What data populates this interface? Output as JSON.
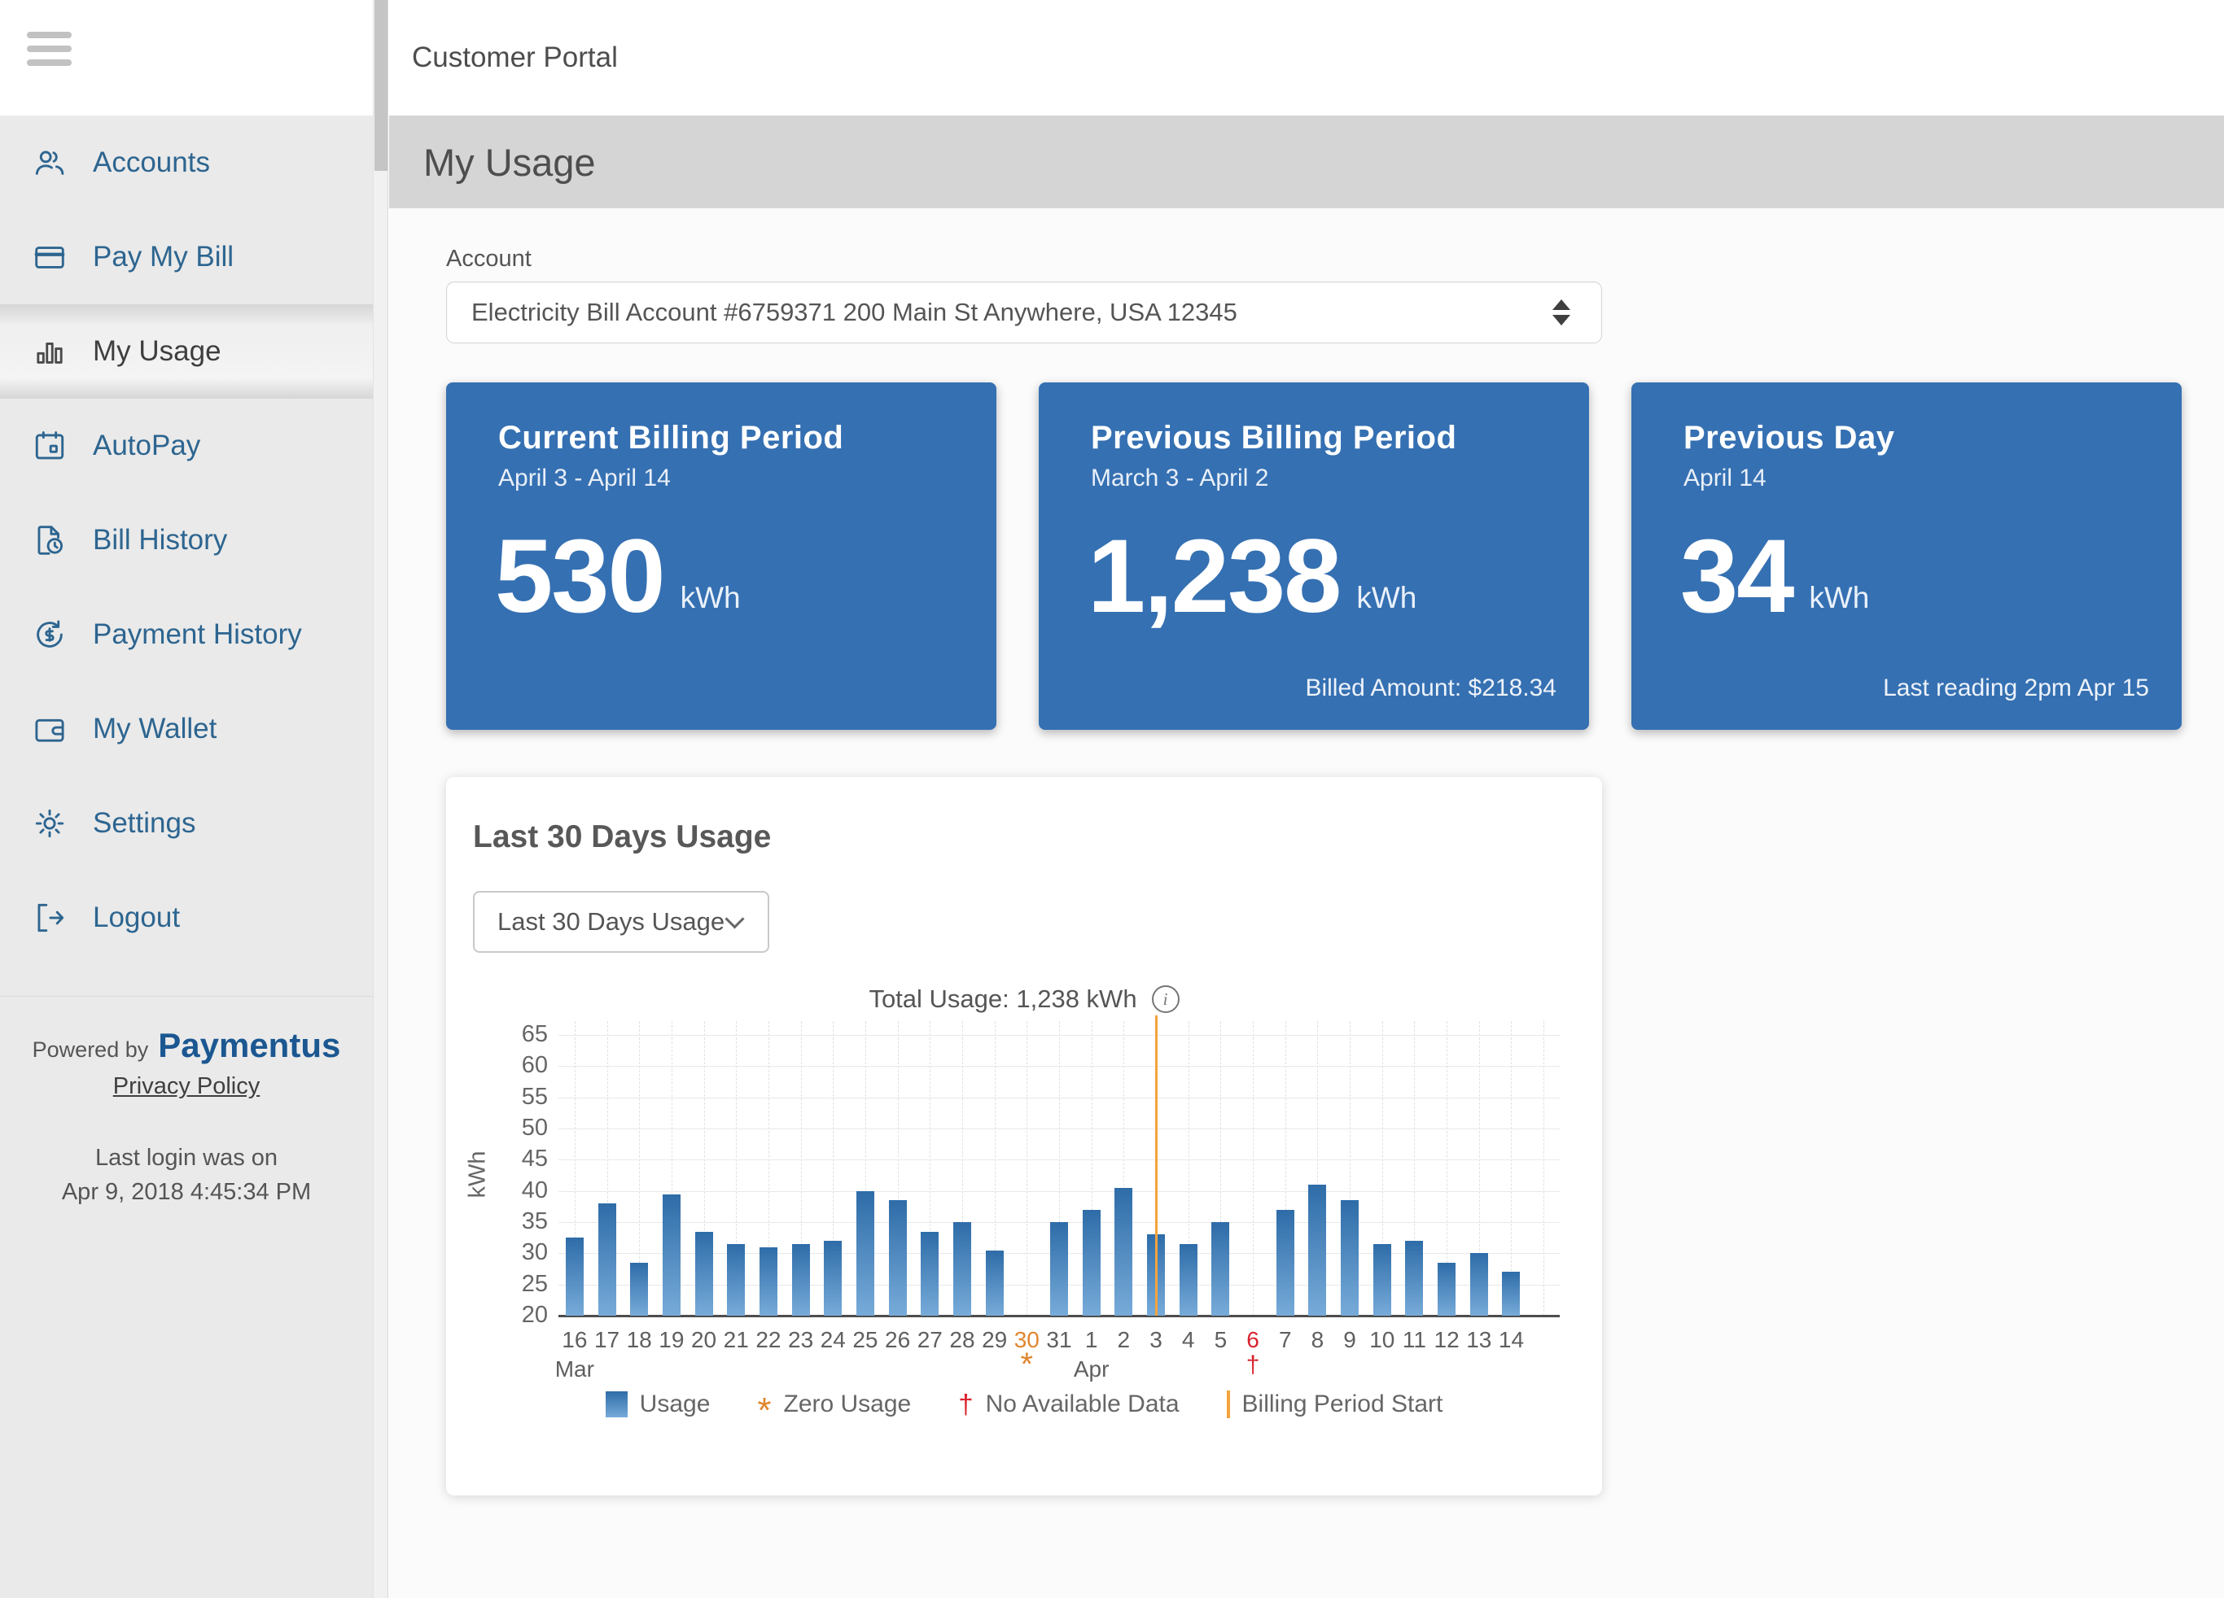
{
  "header": {
    "app_title": "Customer Portal"
  },
  "banner": {
    "page_title": "My Usage"
  },
  "sidebar": {
    "items": [
      {
        "label": "Accounts",
        "icon": "accounts",
        "active": false
      },
      {
        "label": "Pay My Bill",
        "icon": "credit-card",
        "active": false
      },
      {
        "label": "My Usage",
        "icon": "bar-chart",
        "active": true
      },
      {
        "label": "AutoPay",
        "icon": "calendar",
        "active": false
      },
      {
        "label": "Bill History",
        "icon": "document-clock",
        "active": false
      },
      {
        "label": "Payment History",
        "icon": "refresh-dollar",
        "active": false
      },
      {
        "label": "My Wallet",
        "icon": "wallet",
        "active": false
      },
      {
        "label": "Settings",
        "icon": "gear",
        "active": false
      },
      {
        "label": "Logout",
        "icon": "logout",
        "active": false
      }
    ],
    "powered_by": "Powered by",
    "brand": "Paymentus",
    "brand_color": "#1b5791",
    "privacy_policy": "Privacy Policy",
    "last_login_line1": "Last login was on",
    "last_login_line2": "Apr 9, 2018 4:45:34 PM"
  },
  "account": {
    "label": "Account",
    "selected_option": "Electricity Bill Account #6759371 200 Main St Anywhere, USA 12345"
  },
  "summary_cards": [
    {
      "title": "Current Billing Period",
      "subtitle": "April 3 - April 14",
      "value": "530",
      "unit": "kWh",
      "note": ""
    },
    {
      "title": "Previous Billing Period",
      "subtitle": "March 3 - April 2",
      "value": "1,238",
      "unit": "kWh",
      "note": "Billed Amount: $218.34"
    },
    {
      "title": "Previous Day",
      "subtitle": "April 14",
      "value": "34",
      "unit": "kWh",
      "note": "Last reading 2pm Apr 15"
    }
  ],
  "accent_color": "#3570b2",
  "chart_card": {
    "title": "Last 30 Days Usage",
    "dropdown_value": "Last 30 Days Usage",
    "info_glyph": "i"
  },
  "chart_data": {
    "type": "bar",
    "title": "Total Usage: 1,238 kWh",
    "xlabel": "",
    "ylabel": "kWh",
    "ylim": [
      20,
      65
    ],
    "yticks": [
      20,
      25,
      30,
      35,
      40,
      45,
      50,
      55,
      60,
      65
    ],
    "grid": true,
    "legend_position": "bottom",
    "categories": [
      "16",
      "17",
      "18",
      "19",
      "20",
      "21",
      "22",
      "23",
      "24",
      "25",
      "26",
      "27",
      "28",
      "29",
      "30",
      "31",
      "1",
      "2",
      "3",
      "4",
      "5",
      "6",
      "7",
      "8",
      "9",
      "10",
      "11",
      "12",
      "13",
      "14"
    ],
    "month_labels": [
      {
        "index": 0,
        "label": "Mar"
      },
      {
        "index": 16,
        "label": "Apr"
      }
    ],
    "values": [
      32.5,
      38,
      28.5,
      39.5,
      33.5,
      31.5,
      31,
      31.5,
      32,
      40,
      38.5,
      33.5,
      35,
      30.5,
      null,
      35,
      37,
      40.5,
      33,
      31.5,
      35,
      null,
      37,
      41,
      38.5,
      31.5,
      32,
      28.5,
      30,
      27
    ],
    "special": {
      "zero_usage_index": 14,
      "zero_usage_glyph": "*",
      "no_data_index": 21,
      "no_data_glyph": "†",
      "billing_start_index": 18
    },
    "legend": [
      {
        "marker": "bar",
        "label": "Usage"
      },
      {
        "marker": "asterisk",
        "label": "Zero Usage"
      },
      {
        "marker": "dagger",
        "label": "No Available Data"
      },
      {
        "marker": "vline",
        "label": "Billing Period Start"
      }
    ],
    "colors": {
      "bar_top": "#2e6ca8",
      "bar_bottom": "#77abd9",
      "billing_line": "#f5a33c",
      "zero_usage": "#e0862f",
      "no_data": "#d9232e"
    }
  }
}
